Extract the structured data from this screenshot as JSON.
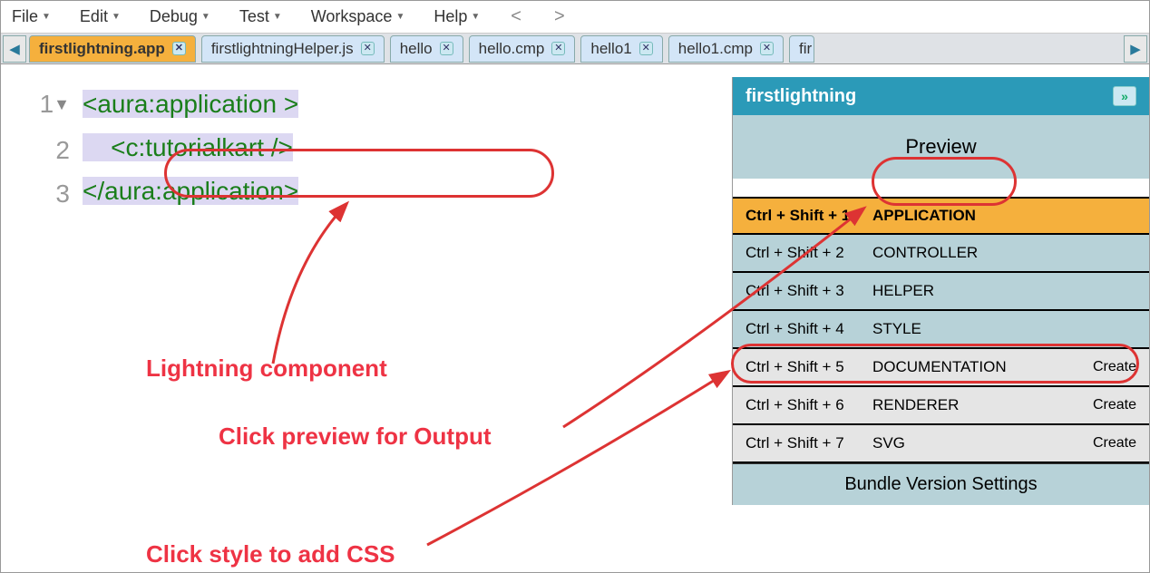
{
  "menubar": {
    "items": [
      {
        "label": "File"
      },
      {
        "label": "Edit"
      },
      {
        "label": "Debug"
      },
      {
        "label": "Test"
      },
      {
        "label": "Workspace"
      },
      {
        "label": "Help"
      }
    ],
    "back": "<",
    "forward": ">"
  },
  "tabs": [
    {
      "label": "firstlightning.app",
      "active": true
    },
    {
      "label": "firstlightningHelper.js"
    },
    {
      "label": "hello"
    },
    {
      "label": "hello.cmp"
    },
    {
      "label": "hello1"
    },
    {
      "label": "hello1.cmp"
    },
    {
      "label": "fir"
    }
  ],
  "gutter": {
    "l1": "1",
    "l2": "2",
    "l3": "3"
  },
  "code": {
    "line1": "<aura:application >",
    "line2": "<c:tutorialkart />",
    "line3": "</aura:application>"
  },
  "annotations": {
    "a1": "Lightning component",
    "a2": "Click preview for Output",
    "a3": "Click style to add CSS"
  },
  "panel": {
    "title": "firstlightning",
    "preview": "Preview",
    "rows": [
      {
        "shortcut": "Ctrl + Shift + 1",
        "label": "APPLICATION",
        "selected": true
      },
      {
        "shortcut": "Ctrl + Shift + 2",
        "label": "CONTROLLER",
        "blue": true
      },
      {
        "shortcut": "Ctrl + Shift + 3",
        "label": "HELPER",
        "blue": true
      },
      {
        "shortcut": "Ctrl + Shift + 4",
        "label": "STYLE",
        "blue": true
      },
      {
        "shortcut": "Ctrl + Shift + 5",
        "label": "DOCUMENTATION",
        "create": "Create"
      },
      {
        "shortcut": "Ctrl + Shift + 6",
        "label": "RENDERER",
        "create": "Create"
      },
      {
        "shortcut": "Ctrl + Shift + 7",
        "label": "SVG",
        "create": "Create"
      }
    ],
    "footer": "Bundle Version Settings"
  }
}
